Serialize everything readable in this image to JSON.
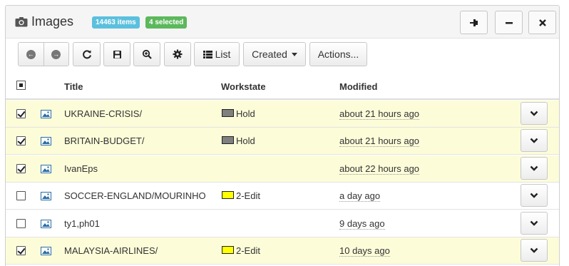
{
  "header": {
    "title": "Images",
    "title_icon": "camera-icon",
    "items_badge": "14463 items",
    "selected_badge": "4 selected",
    "buttons": [
      "pin-icon",
      "minimize-icon",
      "close-icon"
    ]
  },
  "toolbar": {
    "back_icon": "arrow-left-circle-icon",
    "forward_icon": "arrow-right-circle-icon",
    "refresh_icon": "refresh-icon",
    "save_icon": "floppy-disk-icon",
    "zoom_icon": "zoom-in-icon",
    "settings_icon": "gear-icon",
    "list_label": "List",
    "created_label": "Created",
    "actions_label": "Actions..."
  },
  "table": {
    "columns": {
      "title": "Title",
      "workstate": "Workstate",
      "modified": "Modified"
    },
    "rows": [
      {
        "checked": true,
        "title": "UKRAINE-CRISIS/",
        "workstate": "Hold",
        "ws_color": "#808080",
        "modified": "about 21 hours ago"
      },
      {
        "checked": true,
        "title": "BRITAIN-BUDGET/",
        "workstate": "Hold",
        "ws_color": "#808080",
        "modified": "about 21 hours ago"
      },
      {
        "checked": true,
        "title": "IvanEps",
        "workstate": "",
        "ws_color": "",
        "modified": "about 22 hours ago"
      },
      {
        "checked": false,
        "title": "SOCCER-ENGLAND/MOURINHO",
        "workstate": "2-Edit",
        "ws_color": "#ffff00",
        "modified": "a day ago"
      },
      {
        "checked": false,
        "title": "ty1,ph01",
        "workstate": "",
        "ws_color": "",
        "modified": "9 days ago"
      },
      {
        "checked": true,
        "title": "MALAYSIA-AIRLINES/",
        "workstate": "2-Edit",
        "ws_color": "#ffff00",
        "modified": "10 days ago"
      }
    ]
  },
  "colors": {
    "selected_row": "#fcfcd9",
    "badge_info": "#5bc0de",
    "badge_success": "#5cb85c"
  }
}
